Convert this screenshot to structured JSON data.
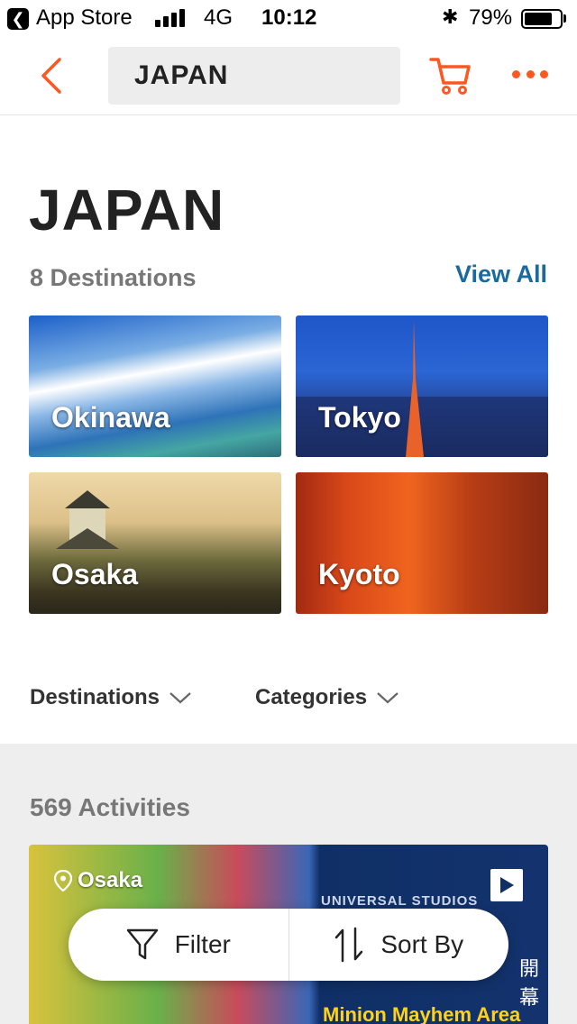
{
  "status_bar": {
    "app": "App Store",
    "network": "4G",
    "time": "10:12",
    "battery_pct": "79%",
    "battery_level": 0.79,
    "bluetooth_icon": "bluetooth-icon"
  },
  "nav": {
    "search_text": "JAPAN",
    "back_icon": "chevron-left-icon",
    "cart_icon": "cart-icon",
    "more_icon": "more-dots-icon",
    "accent_color": "#ff5722"
  },
  "header": {
    "title": "JAPAN",
    "destinations_count": "8 Destinations",
    "view_all": "View All",
    "link_color": "#1a6aa0"
  },
  "destinations": [
    {
      "name": "Okinawa"
    },
    {
      "name": "Tokyo"
    },
    {
      "name": "Osaka"
    },
    {
      "name": "Kyoto"
    }
  ],
  "filters": {
    "destinations_label": "Destinations",
    "categories_label": "Categories"
  },
  "activities": {
    "count_label": "569 Activities",
    "card": {
      "location": "Osaka",
      "brand_text": "UNIVERSAL STUDIOS UNIVERSAL STUDIO",
      "jp_text": "開幕",
      "title": "Minion Mayhem Area"
    }
  },
  "float_actions": {
    "filter_label": "Filter",
    "sort_label": "Sort By"
  }
}
